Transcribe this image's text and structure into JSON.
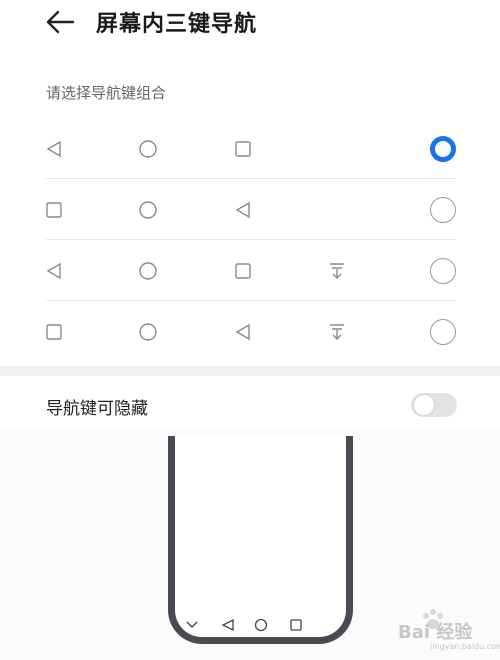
{
  "header": {
    "title": "屏幕内三键导航",
    "back_icon": "arrow-left-icon"
  },
  "section": {
    "label": "请选择导航键组合"
  },
  "options": [
    {
      "keys": [
        "back-triangle-icon",
        "home-circle-icon",
        "recent-square-icon"
      ],
      "selected": true
    },
    {
      "keys": [
        "recent-square-icon",
        "home-circle-icon",
        "back-triangle-icon"
      ],
      "selected": false
    },
    {
      "keys": [
        "back-triangle-icon",
        "home-circle-icon",
        "recent-square-icon",
        "notification-pull-down-icon"
      ],
      "selected": false
    },
    {
      "keys": [
        "recent-square-icon",
        "home-circle-icon",
        "back-triangle-icon",
        "notification-pull-down-icon"
      ],
      "selected": false
    }
  ],
  "toggle": {
    "label": "导航键可隐藏",
    "on": false
  },
  "preview": {
    "nav_keys": [
      "chevron-down-icon",
      "back-triangle-icon",
      "home-circle-icon",
      "recent-square-icon"
    ]
  },
  "watermark": {
    "text": "Bai 经验",
    "subtext": "jingyan.baidu.com"
  },
  "colors": {
    "accent": "#1a73e8",
    "icon_gray": "#8a8a8a",
    "divider": "#e6e6e6",
    "phone_frame": "#4a4a52"
  }
}
